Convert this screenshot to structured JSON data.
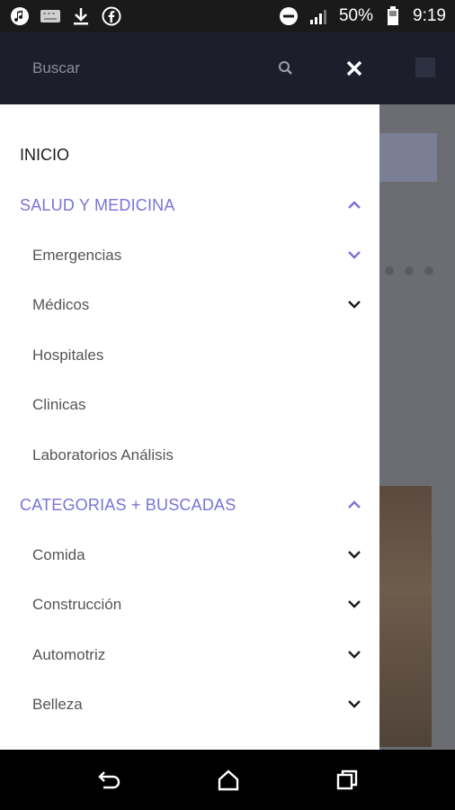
{
  "status_bar": {
    "battery_percent": "50%",
    "time": "9:19",
    "icons": [
      "music-icon",
      "keyboard-icon",
      "download-icon",
      "facebook-icon",
      "dnd-icon",
      "signal-icon",
      "battery-icon"
    ]
  },
  "header": {
    "search_placeholder": "Buscar",
    "icons": [
      "search-icon",
      "close-icon"
    ]
  },
  "drawer": {
    "home": "INICIO",
    "sections": [
      {
        "label": "SALUD Y MEDICINA",
        "expanded": true,
        "items": [
          {
            "label": "Emergencias",
            "has_submenu": true,
            "chevron_color": "#7b73d6"
          },
          {
            "label": "Médicos",
            "has_submenu": true
          },
          {
            "label": "Hospitales",
            "has_submenu": false
          },
          {
            "label": "Clinicas",
            "has_submenu": false
          },
          {
            "label": "Laboratorios Análisis",
            "has_submenu": false
          }
        ]
      },
      {
        "label": "CATEGORIAS + BUSCADAS",
        "expanded": true,
        "items": [
          {
            "label": "Comida",
            "has_submenu": true
          },
          {
            "label": "Construcción",
            "has_submenu": true
          },
          {
            "label": "Automotriz",
            "has_submenu": true
          },
          {
            "label": "Belleza",
            "has_submenu": true
          }
        ]
      }
    ]
  },
  "colors": {
    "accent": "#7b73d6",
    "header_bg": "#1c1f2b",
    "text_dark": "#1a1a1a",
    "text_muted": "#555555"
  },
  "nav_bar": {
    "icons": [
      "back-icon",
      "home-icon",
      "recents-icon"
    ]
  }
}
